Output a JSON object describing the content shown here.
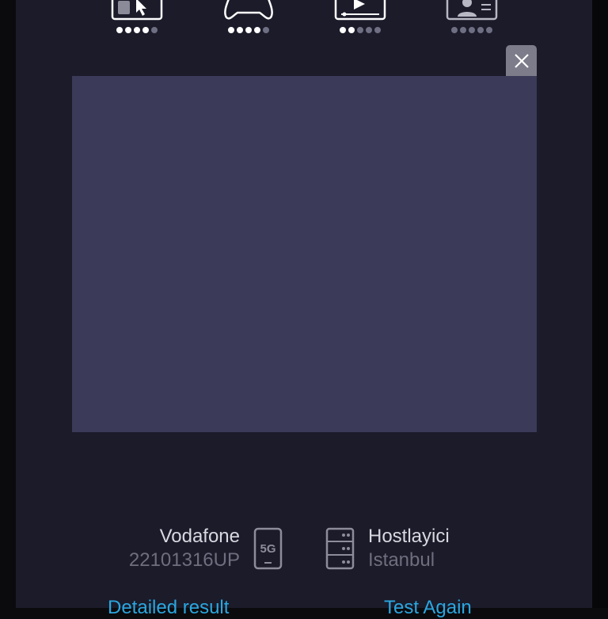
{
  "metrics": [
    {
      "icon": "browsing-icon",
      "rating": 4,
      "max": 5
    },
    {
      "icon": "gamepad-icon",
      "rating": 4,
      "max": 5
    },
    {
      "icon": "video-icon",
      "rating": 2,
      "max": 5
    },
    {
      "icon": "video-call-icon",
      "rating": 0,
      "max": 5
    }
  ],
  "provider": {
    "isp_name": "Vodafone",
    "ip": "22101316UP",
    "network_badge": "5G",
    "host_name": "Hostlayici",
    "host_city": "Istanbul"
  },
  "actions": {
    "detailed_label": "Detailed result",
    "test_again_label": "Test Again"
  },
  "colors": {
    "panel": "#1b1b2a",
    "ad_box": "#3b3a58",
    "link": "#2aa7e0",
    "dot_on": "#ffffff",
    "dot_off": "#6f6f83"
  }
}
